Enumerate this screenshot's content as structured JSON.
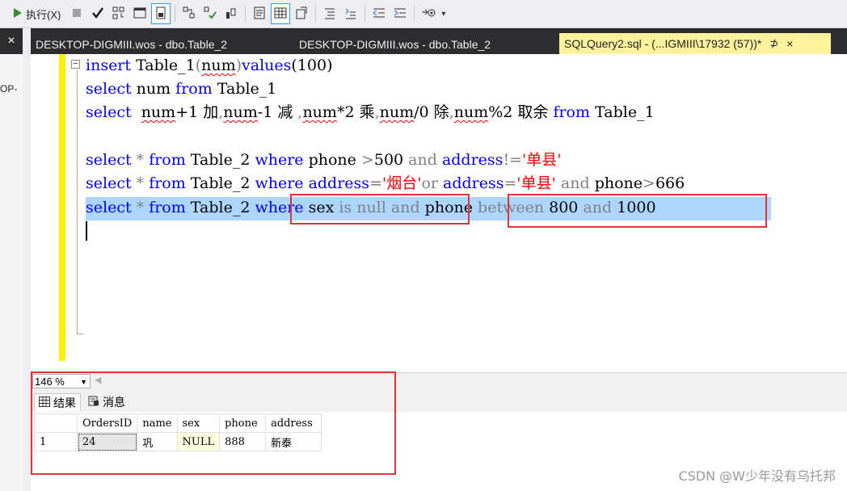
{
  "toolbar": {
    "execute_label": "执行(X)"
  },
  "tabs": [
    {
      "label": "DESKTOP-DIGMIII.wos - dbo.Table_2"
    },
    {
      "label": "DESKTOP-DIGMIII.wos - dbo.Table_2"
    },
    {
      "label": "SQLQuery2.sql - (...IGMIII\\17932 (57))*",
      "pin": "⊅",
      "close": "×"
    }
  ],
  "left_panel": {
    "close": "×",
    "label": "OP-"
  },
  "editor": {
    "fold_marker": "−",
    "lines": [
      {
        "t1": "insert",
        "t2": " Table_1",
        "t3": "(",
        "t4": "num",
        "t5": ")",
        "t6": "values",
        "t7": "(100)"
      },
      {
        "t1": "select",
        "t2": " num ",
        "t3": "from",
        "t4": " Table_1"
      },
      {
        "t1": "select",
        "t2": "  ",
        "t3": "num",
        "t4": "+1 加",
        "t5": ",",
        "t6": "num",
        "t7": "-1 减 ",
        "t8": ",",
        "t9": "num",
        "t10": "*2 乘",
        "t11": ",",
        "t12": "num",
        "t13": "/0 除",
        "t14": ",",
        "t15": "num",
        "t16": "%2 取余 ",
        "t17": "from",
        "t18": " Table_1"
      },
      {
        "t1": "select",
        "t2": " * ",
        "t3": "from",
        "t4": " Table_2 ",
        "t5": "where",
        "t6": " phone ",
        "t7": ">",
        "t8": "500 ",
        "t9": "and",
        "t10": " address",
        "t11": "!=",
        "t12": "'单县'"
      },
      {
        "t1": "select",
        "t2": " * ",
        "t3": "from",
        "t4": " Table_2 ",
        "t5": "where",
        "t6": " address",
        "t7": "=",
        "t8": "'烟台'",
        "t9": "or",
        "t10": " address",
        "t11": "=",
        "t12": "'单县' ",
        "t13": "and",
        "t14": " phone",
        "t15": ">",
        "t16": "666"
      },
      {
        "t1": "select",
        "t2": " * ",
        "t3": "from",
        "t4": " Table_2 ",
        "t5": "where",
        "t6": " sex ",
        "t7": "is",
        "t8": " ",
        "t9": "null",
        "t10": " ",
        "t11": "and",
        "t12": " phone ",
        "t13": "between",
        "t14": " 800 ",
        "t15": "and",
        "t16": " 1000"
      }
    ]
  },
  "zoom": {
    "value": "146 %",
    "arrow": "▼",
    "scroll": "◀"
  },
  "results": {
    "tabs": [
      {
        "label": "结果"
      },
      {
        "label": "消息"
      }
    ],
    "columns": [
      "OrdersID",
      "name",
      "sex",
      "phone",
      "address"
    ],
    "rows": [
      {
        "rownum": "1",
        "cells": [
          "24",
          "巩",
          "NULL",
          "888",
          "新泰"
        ]
      }
    ]
  },
  "watermark": "CSDN @W少年没有乌托邦",
  "colors": {
    "keyword": "#0000FF",
    "string": "#FF0000",
    "operator": "#808080",
    "selection": "#ADD6FF",
    "highlight_box": "#E53333",
    "active_tab": "#FFF29D"
  }
}
